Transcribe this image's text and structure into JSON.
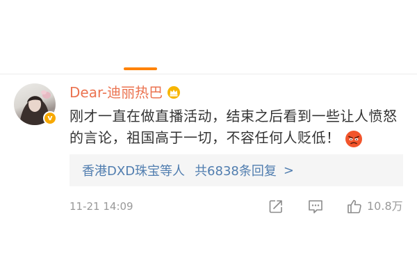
{
  "comment": {
    "username": "Dear-迪丽热巴",
    "text": "刚才一直在做直播活动，结束之后看到一些让人愤怒的言论，祖国高于一切，不容任何人贬低！",
    "emoji": "angry-face-emoji"
  },
  "replies": {
    "users": "香港DXD珠宝等人",
    "count": "共6838条回复",
    "chevron": ">"
  },
  "footer": {
    "timestamp": "11-21 14:09",
    "likes": "10.8万"
  },
  "badge": {
    "symbol": "v"
  },
  "colors": {
    "accent": "#ff8200",
    "username": "#eb7350",
    "link": "#507daf",
    "text": "#333333",
    "muted": "#999999",
    "reply_bg": "#f5f5f5"
  },
  "icons": [
    "crown-icon",
    "share-icon",
    "comment-icon",
    "like-icon",
    "verified-badge-icon"
  ]
}
